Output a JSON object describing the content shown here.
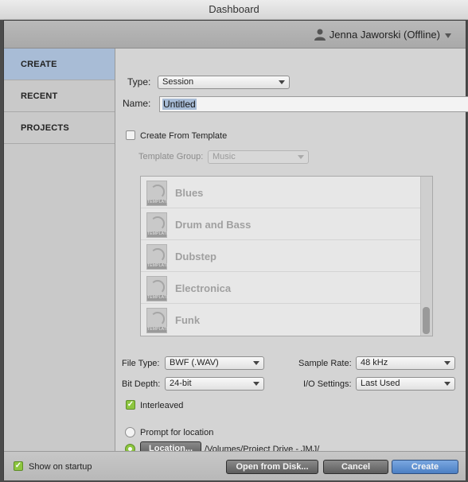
{
  "window": {
    "title": "Dashboard"
  },
  "user": {
    "name": "Jenna Jaworski (Offline)"
  },
  "sidebar": {
    "items": [
      {
        "label": "CREATE",
        "active": true
      },
      {
        "label": "RECENT",
        "active": false
      },
      {
        "label": "PROJECTS",
        "active": false
      }
    ]
  },
  "form": {
    "type_label": "Type:",
    "type_value": "Session",
    "name_label": "Name:",
    "name_value": "Untitled",
    "create_from_template_label": "Create From Template",
    "create_from_template_checked": false,
    "template_group_label": "Template Group:",
    "template_group_value": "Music",
    "templates": [
      {
        "name": "Blues"
      },
      {
        "name": "Drum and Bass"
      },
      {
        "name": "Dubstep"
      },
      {
        "name": "Electronica"
      },
      {
        "name": "Funk"
      }
    ],
    "template_icon_text": "TEMPLATE",
    "file_type_label": "File Type:",
    "file_type_value": "BWF (.WAV)",
    "sample_rate_label": "Sample Rate:",
    "sample_rate_value": "48 kHz",
    "bit_depth_label": "Bit Depth:",
    "bit_depth_value": "24-bit",
    "io_settings_label": "I/O Settings:",
    "io_settings_value": "Last Used",
    "interleaved_label": "Interleaved",
    "interleaved_checked": true,
    "prompt_location_label": "Prompt for location",
    "location_button": "Location...",
    "location_path": "/Volumes/Project Drive - JMJ/"
  },
  "footer": {
    "show_on_startup_label": "Show on startup",
    "show_on_startup_checked": true,
    "open_from_disk": "Open from Disk...",
    "cancel": "Cancel",
    "create": "Create"
  },
  "colors": {
    "accent": "#4b7fc4",
    "selection": "#a8bcd6",
    "check_green": "#8dc63f"
  }
}
